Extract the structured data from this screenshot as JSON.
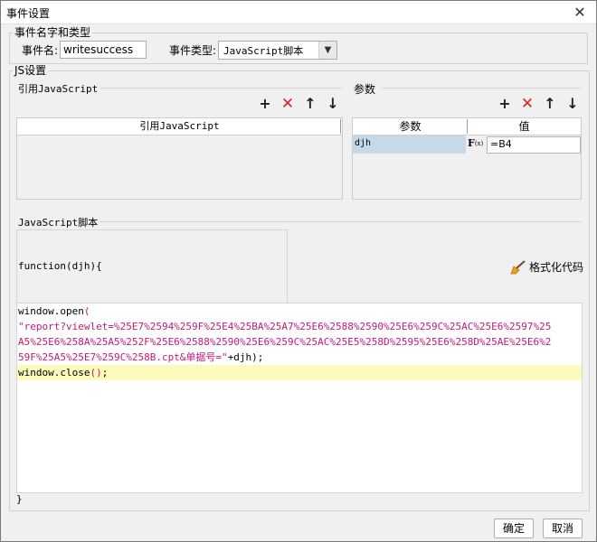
{
  "window": {
    "title": "事件设置",
    "close_glyph": "✕"
  },
  "event_group": {
    "legend": "事件名字和类型",
    "name_label": "事件名:",
    "name_value": "writesuccess",
    "type_label": "事件类型:",
    "type_value": "JavaScript脚本"
  },
  "js_group": {
    "legend": "JS设置"
  },
  "ref_js": {
    "section_label": "引用JavaScript",
    "column_header": "引用JavaScript",
    "toolbar": {
      "add": "+",
      "delete": "✕",
      "up": "↑",
      "down": "↓"
    }
  },
  "params": {
    "section_label": "参数",
    "columns": [
      "参数",
      "值"
    ],
    "toolbar": {
      "add": "+",
      "delete": "✕",
      "up": "↑",
      "down": "↓"
    },
    "rows": [
      {
        "name": "djh",
        "value": "=B4"
      }
    ]
  },
  "script": {
    "section_label": "JavaScript脚本",
    "function_header": "function(djh){",
    "format_button": "格式化代码",
    "lines": [
      {
        "plain": "window.open",
        "paren": "("
      },
      {
        "str": "\"report?viewlet=%25E7%2594%259F%25E4%25BA%25A7%25E6%2588%2590%25E6%259C%25AC%25E6%2597%25"
      },
      {
        "str": "A5%25E6%258A%25A5%252F%25E6%2588%2590%25E6%259C%25AC%25E5%258D%2595%25E6%258D%25AE%25E6%2"
      },
      {
        "str": "59F%25A5%25E7%259C%258B.cpt&单据号=\"",
        "plain": "+djh);"
      },
      {
        "plain": "window.close",
        "paren": "()",
        "tail": ";"
      }
    ],
    "closing": "}"
  },
  "buttons": {
    "ok": "确定",
    "cancel": "取消"
  }
}
